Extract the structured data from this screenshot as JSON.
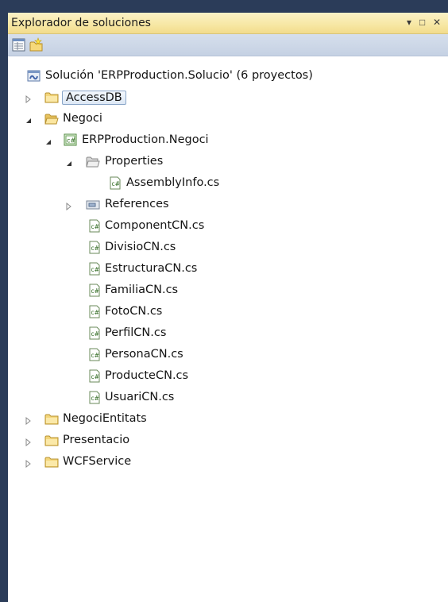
{
  "panel": {
    "title": "Explorador de soluciones",
    "window_buttons": {
      "pin": "▾",
      "maximize": "□",
      "close": "✕"
    }
  },
  "toolbar": {
    "buttons": [
      {
        "icon": "properties-icon"
      },
      {
        "icon": "new-folder-icon"
      }
    ]
  },
  "tree": {
    "solution": "Solución 'ERPProduction.Solucio'  (6 proyectos)",
    "items": [
      {
        "label": "AccessDB",
        "selected": true
      },
      {
        "label": "Negoci"
      },
      {
        "label": "ERPProduction.Negoci"
      },
      {
        "label": "Properties"
      },
      {
        "label": "AssemblyInfo.cs"
      },
      {
        "label": "References"
      },
      {
        "label": "ComponentCN.cs"
      },
      {
        "label": "DivisioCN.cs"
      },
      {
        "label": "EstructuraCN.cs"
      },
      {
        "label": "FamiliaCN.cs"
      },
      {
        "label": "FotoCN.cs"
      },
      {
        "label": "PerfilCN.cs"
      },
      {
        "label": "PersonaCN.cs"
      },
      {
        "label": "ProducteCN.cs"
      },
      {
        "label": "UsuariCN.cs"
      },
      {
        "label": "NegociEntitats"
      },
      {
        "label": "Presentacio"
      },
      {
        "label": "WCFService"
      }
    ]
  }
}
